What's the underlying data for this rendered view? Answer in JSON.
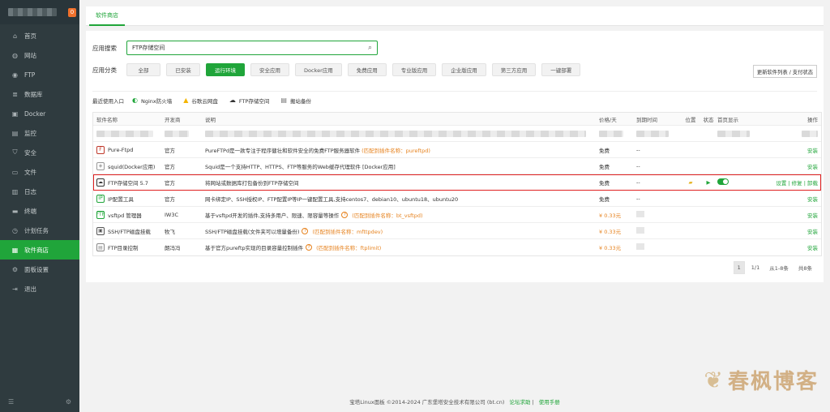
{
  "sidebar": {
    "badge": "0",
    "items": [
      {
        "icon": "home-icon",
        "glyph": "⌂",
        "label": "首页"
      },
      {
        "icon": "globe-icon",
        "glyph": "◍",
        "label": "网站"
      },
      {
        "icon": "ftp-icon",
        "glyph": "◉",
        "label": "FTP"
      },
      {
        "icon": "database-icon",
        "glyph": "≣",
        "label": "数据库"
      },
      {
        "icon": "docker-icon",
        "glyph": "▣",
        "label": "Docker"
      },
      {
        "icon": "monitor-icon",
        "glyph": "▤",
        "label": "监控"
      },
      {
        "icon": "shield-icon",
        "glyph": "⛉",
        "label": "安全"
      },
      {
        "icon": "folder-icon",
        "glyph": "▭",
        "label": "文件"
      },
      {
        "icon": "log-icon",
        "glyph": "▥",
        "label": "日志"
      },
      {
        "icon": "terminal-icon",
        "glyph": "▬",
        "label": "终端"
      },
      {
        "icon": "clock-icon",
        "glyph": "◷",
        "label": "计划任务"
      },
      {
        "icon": "store-icon",
        "glyph": "▦",
        "label": "软件商店"
      },
      {
        "icon": "settings-icon",
        "glyph": "⚙",
        "label": "面板设置"
      },
      {
        "icon": "logout-icon",
        "glyph": "⇥",
        "label": "退出"
      }
    ],
    "active_index": 11
  },
  "tab": {
    "label": "软件商店"
  },
  "search": {
    "label": "应用搜索",
    "value": "FTP存储空间"
  },
  "category": {
    "label": "应用分类",
    "items": [
      "全部",
      "已安装",
      "运行环境",
      "安全应用",
      "Docker应用",
      "免费应用",
      "专业版应用",
      "企业版应用",
      "第三方应用",
      "一键部署"
    ],
    "active_index": 2
  },
  "update_button": "更新软件列表 / 支付状态",
  "recent": {
    "title": "最近使用入口",
    "items": [
      {
        "icon": "nginx-firewall-icon",
        "label": "Nginx防火墙",
        "color": "#20a53a",
        "glyph": "◐"
      },
      {
        "icon": "google-drive-icon",
        "label": "谷歌云网盘",
        "color": "#f4b400",
        "glyph": "▲"
      },
      {
        "icon": "cloud-icon",
        "label": "FTP存储空间",
        "color": "#333333",
        "glyph": "☁"
      },
      {
        "icon": "backup-icon",
        "label": "搬站备份",
        "color": "#777777",
        "glyph": "▤"
      }
    ]
  },
  "table": {
    "headers": {
      "name": "软件名称",
      "dev": "开发商",
      "desc": "说明",
      "price": "价格/天",
      "expire": "到期时间",
      "pos": "位置",
      "status": "状态",
      "home": "首页显示",
      "op": "操作"
    },
    "rows": [
      {
        "name": "Pure-Ftpd",
        "icon": "pureftpd-icon",
        "glyph": "F",
        "icon_color": "#c0392b",
        "dev": "官方",
        "desc": "PureFTPd是一款专注于程序健壮和软件安全的免费FTP服务器软件",
        "hl": "(匹配到插件名称：pureftpd)",
        "price": "免费",
        "expire": "--",
        "op": "安装"
      },
      {
        "name": "squid(Docker应用)",
        "icon": "squid-icon",
        "glyph": "◈",
        "icon_color": "#999999",
        "dev": "官方",
        "desc": "Squid是一个支持HTTP、HTTPS、FTP等服务的Web缓存代理软件 [Docker应用]",
        "hl": "",
        "price": "免费",
        "expire": "--",
        "op": "安装"
      },
      {
        "name": "FTP存储空间 5.7",
        "icon": "cloud-storage-icon",
        "glyph": "☁",
        "icon_color": "#333333",
        "dev": "官方",
        "desc": "将网站或数据库打包备份到FTP存储空间",
        "hl": "",
        "price": "免费",
        "expire": "--",
        "op": "设置 | 修复 | 卸载",
        "selected": true
      },
      {
        "name": "IP配置工具",
        "icon": "ip-icon",
        "glyph": "IP",
        "icon_color": "#20a53a",
        "dev": "官方",
        "desc": "网卡绑定IP、SSH授权IP、FTP配置IP等IP一键配置工具,支持centos7、debian10、ubuntu18、ubuntu20",
        "hl": "",
        "price": "免费",
        "expire": "--",
        "op": "安装"
      },
      {
        "name": "vsftpd 管理器",
        "icon": "vsftpd-icon",
        "glyph": "FTP",
        "icon_color": "#20a53a",
        "dev": "IW3C",
        "desc": "基于vsftpd开发的插件,支持多用户、限速、限容量等操作",
        "hl": "(匹配到插件名称：bt_vsftpd)",
        "q": true,
        "price": "¥ 0.33元",
        "expire": "",
        "op": "安装"
      },
      {
        "name": "SSH/FTP磁盘挂载",
        "icon": "disk-mount-icon",
        "glyph": "▣",
        "icon_color": "#555555",
        "dev": "牧飞",
        "desc": "SSH/FTP磁盘挂载(文件夹可以增量备份)",
        "hl": "(匹配到插件名称：mfttpdev)",
        "q": true,
        "price": "¥ 0.33元",
        "expire": "",
        "op": "安装"
      },
      {
        "name": "FTP目录控制",
        "icon": "ftp-dir-icon",
        "glyph": "▤",
        "icon_color": "#888888",
        "dev": "朗冯冯",
        "desc": "基于官方pureftp实现的目录容量控制插件",
        "hl": "(匹配到插件名称：ftplimit)",
        "q": true,
        "price": "¥ 0.33元",
        "expire": "",
        "op": "安装"
      }
    ]
  },
  "pager": {
    "current": "1",
    "pages": "1/1",
    "range": "从1-8条",
    "total": "共8条"
  },
  "footer": {
    "copyright": "宝塔Linux面板 ©2014-2024 广东堡塔安全技术有限公司 (bt.cn)",
    "link1": "论坛求助",
    "link2": "使用手册"
  },
  "watermark": {
    "text": "春枫博客"
  }
}
